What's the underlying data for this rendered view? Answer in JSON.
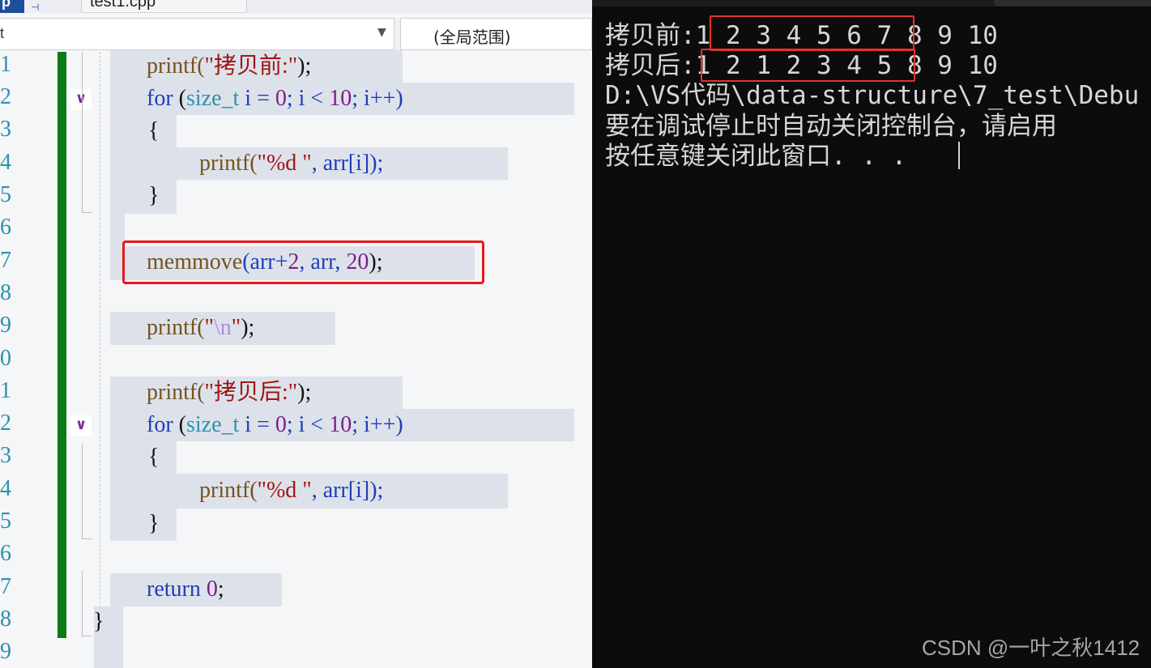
{
  "editor": {
    "tabs": {
      "partial_tab": "p",
      "pin_glyph": "⊣",
      "file_tab": "test1.cpp"
    },
    "nav": {
      "left_value": "t",
      "dropdown_glyph": "▼",
      "scope_value": "(全局范围)"
    },
    "fold_glyph": "∨",
    "line_numbers": [
      "1",
      "2",
      "3",
      "4",
      "5",
      "6",
      "7",
      "8",
      "9",
      "0",
      "1",
      "2",
      "3",
      "4",
      "5",
      "6",
      "7",
      "8",
      "9"
    ],
    "code": {
      "l1": [
        "printf(",
        "\"拷贝前:\"",
        ");"
      ],
      "l2": [
        "for",
        " (",
        "size_t",
        " i = ",
        "0",
        "; i < ",
        "10",
        "; i++)"
      ],
      "l3": "{",
      "l4": [
        "printf(",
        "\"%d \"",
        ", arr[i]);"
      ],
      "l5": "}",
      "l7": [
        "memmove",
        "(arr+",
        "2",
        ", arr, ",
        "20",
        ");"
      ],
      "l9": [
        "printf(",
        "\"",
        "\\n",
        "\"",
        ");"
      ],
      "l11": [
        "printf(",
        "\"拷贝后:\"",
        ");"
      ],
      "l12": [
        "for",
        " (",
        "size_t",
        " i = ",
        "0",
        "; i < ",
        "10",
        "; i++)"
      ],
      "l13": "{",
      "l14": [
        "printf(",
        "\"%d \"",
        ", arr[i]);"
      ],
      "l15": "}",
      "l17": [
        "return",
        " ",
        "0",
        ";"
      ],
      "l18": "}"
    },
    "colors": {
      "change_bar": "#0c7a16",
      "highlight_box": "#e41b1b",
      "keyword": "#1f3eb8",
      "type": "#2b91af",
      "string": "#a31515"
    }
  },
  "console": {
    "lines": [
      {
        "prefix": "拷贝前:",
        "boxed": "1 2 3 4 5 6 7",
        "rest": " 8 9 10"
      },
      {
        "prefix": "拷贝后",
        "boxed": ":1 2 1 2 3 4 5",
        "rest": " 8 9 10"
      },
      {
        "text": "D:\\VS代码\\data-structure\\7_test\\Debu"
      },
      {
        "text": "要在调试停止时自动关闭控制台，请启用"
      },
      {
        "text": "按任意键关闭此窗口. . ."
      }
    ],
    "watermark": "CSDN @一叶之秋1412",
    "colors": {
      "background": "#0c0c0c",
      "text": "#d6d6d6",
      "box": "#e4322b"
    }
  }
}
